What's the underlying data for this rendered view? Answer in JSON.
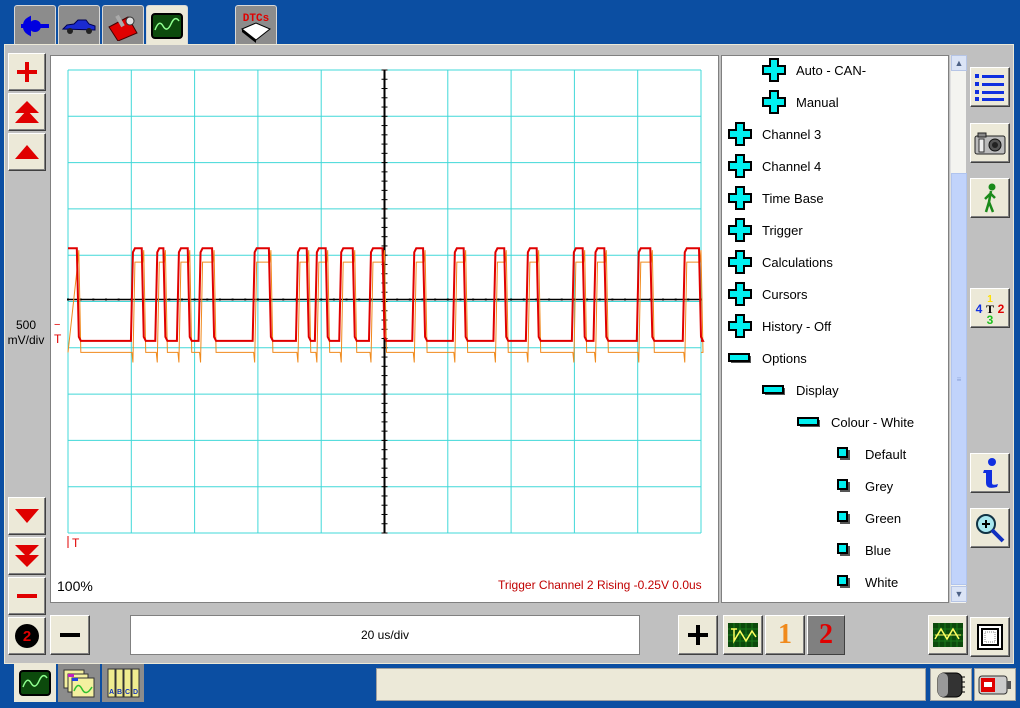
{
  "top_tabs": [
    {
      "name": "connector",
      "icon": "connector-icon",
      "active": false
    },
    {
      "name": "vehicle",
      "icon": "car-icon",
      "active": false
    },
    {
      "name": "toolbox",
      "icon": "toolbox-icon",
      "active": false
    },
    {
      "name": "scope",
      "icon": "oscilloscope-icon",
      "active": true
    },
    {
      "name": "dtcs",
      "icon": "dtc-icon",
      "label": "DTCs",
      "active": false
    }
  ],
  "left_toolbar": {
    "zoom_in_label": "+",
    "zoom_out_label": "−",
    "channel_badge": "2"
  },
  "scope": {
    "volts_per_div": "500",
    "volts_unit": "mV/div",
    "trigger_marker": "T",
    "zoom_percent": "100%",
    "trigger_text": "Trigger Channel 2 Rising -0.25V 0.0us",
    "timebase": "20 us/div",
    "timebase_minus": "−",
    "timebase_plus": "+"
  },
  "channel_buttons": [
    {
      "label": "1",
      "color": "#f08a1c",
      "selected": false
    },
    {
      "label": "2",
      "color": "#e00000",
      "selected": true
    }
  ],
  "tree": {
    "items": [
      {
        "label": "Auto - CAN-",
        "level": 1,
        "state": "collapsed"
      },
      {
        "label": "Manual",
        "level": 1,
        "state": "collapsed"
      },
      {
        "label": "Channel 3",
        "level": 0,
        "state": "collapsed"
      },
      {
        "label": "Channel 4",
        "level": 0,
        "state": "collapsed"
      },
      {
        "label": "Time Base",
        "level": 0,
        "state": "collapsed"
      },
      {
        "label": "Trigger",
        "level": 0,
        "state": "collapsed"
      },
      {
        "label": "Calculations",
        "level": 0,
        "state": "collapsed"
      },
      {
        "label": "Cursors",
        "level": 0,
        "state": "collapsed"
      },
      {
        "label": "History - Off",
        "level": 0,
        "state": "collapsed"
      },
      {
        "label": "Options",
        "level": 0,
        "state": "expanded"
      },
      {
        "label": "Display",
        "level": 1,
        "state": "expanded"
      },
      {
        "label": "Colour - White",
        "level": 2,
        "state": "expanded"
      },
      {
        "label": "Default",
        "level": 3,
        "state": "leaf"
      },
      {
        "label": "Grey",
        "level": 3,
        "state": "leaf"
      },
      {
        "label": "Green",
        "level": 3,
        "state": "leaf"
      },
      {
        "label": "Blue",
        "level": 3,
        "state": "leaf"
      },
      {
        "label": "White",
        "level": 3,
        "state": "leaf"
      }
    ]
  },
  "right_toolbar": [
    {
      "name": "list",
      "icon": "list-icon"
    },
    {
      "name": "snapshot",
      "icon": "camera-icon"
    },
    {
      "name": "walk",
      "icon": "walking-man-icon"
    },
    {
      "name": "channel-trigger",
      "icon": "channel-trigger-icon"
    },
    {
      "name": "info",
      "icon": "info-icon"
    },
    {
      "name": "magnify",
      "icon": "magnifier-icon"
    }
  ],
  "bottom_tabs": [
    {
      "name": "scope",
      "icon": "oscilloscope-icon",
      "active": true
    },
    {
      "name": "library",
      "icon": "waveform-library-icon",
      "active": false
    },
    {
      "name": "binders",
      "icon": "abcd-binders-icon",
      "label": "ABCD",
      "active": false
    }
  ],
  "status_bar": {
    "text": ""
  },
  "colors": {
    "channel1": "#f08a1c",
    "channel2": "#e00000",
    "grid": "#40d8d8",
    "accent": "#0b4ea2"
  }
}
